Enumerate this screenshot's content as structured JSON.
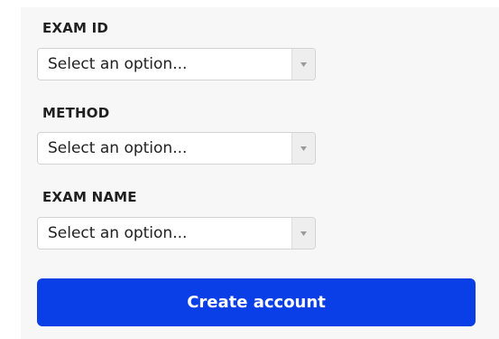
{
  "form": {
    "fields": [
      {
        "label": "EXAM ID",
        "value": "Select an option..."
      },
      {
        "label": "METHOD",
        "value": "Select an option..."
      },
      {
        "label": "EXAM NAME",
        "value": "Select an option..."
      }
    ],
    "submit_label": "Create account"
  },
  "colors": {
    "button": "#0a3ee6",
    "panel": "#f7f7f7"
  },
  "icons": {
    "dropdown": "triangle-down-icon"
  }
}
